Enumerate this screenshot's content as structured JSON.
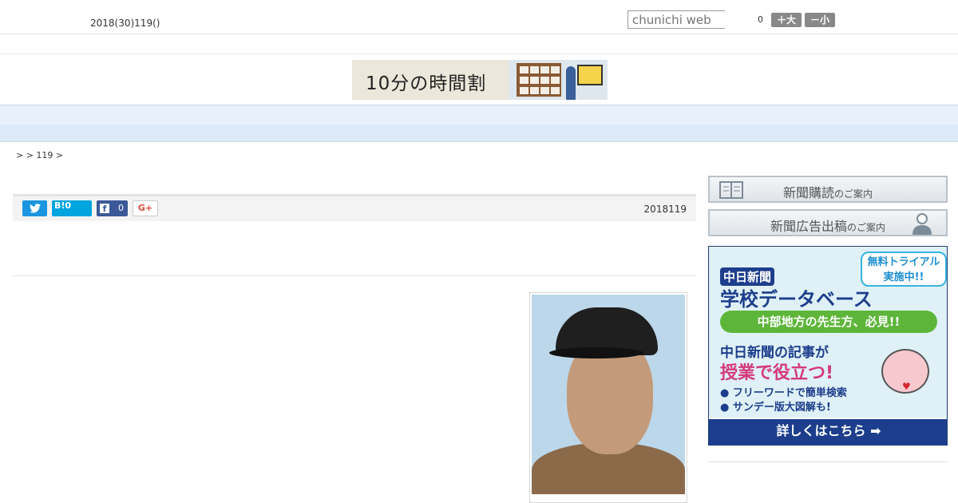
{
  "header": {
    "date": "2018(30)119()",
    "search_placeholder": "chunichi web",
    "count": "0",
    "size_big_label": "＋大",
    "size_small_label": "－小"
  },
  "banner": {
    "text": "10分の時間割"
  },
  "nav": {
    "items": [
      "",
      "",
      "",
      "",
      "",
      "",
      "",
      "",
      ""
    ]
  },
  "breadcrumb": ">  > 119 >",
  "share": {
    "twitter_icon": "twitter-icon",
    "hatena_label": "B!",
    "hatena_count": "0",
    "facebook_count": "0",
    "gplus_label": "G+"
  },
  "article": {
    "date": "2018119"
  },
  "sidebar": {
    "subscribe_main": "新聞購読",
    "subscribe_sub": "のご案内",
    "ad_main": "新聞広告出稿",
    "ad_sub": "のご案内"
  },
  "school_ad": {
    "brand_small": "中日新聞",
    "brand_large": "学校データベース",
    "trial_line1": "無料トライアル",
    "trial_line2": "実施中!!",
    "pill": "中部地方の先生方、必見!!",
    "head1": "中日新聞の記事が",
    "head2": "授業で役立つ!",
    "bullet1": "● フリーワードで簡単検索",
    "bullet2": "● サンデー版大図解も!",
    "cta": "詳しくはこちら ➡",
    "accent_colors": {
      "navy": "#1c3e8c",
      "green": "#5db639",
      "pink": "#d43a7a"
    }
  }
}
